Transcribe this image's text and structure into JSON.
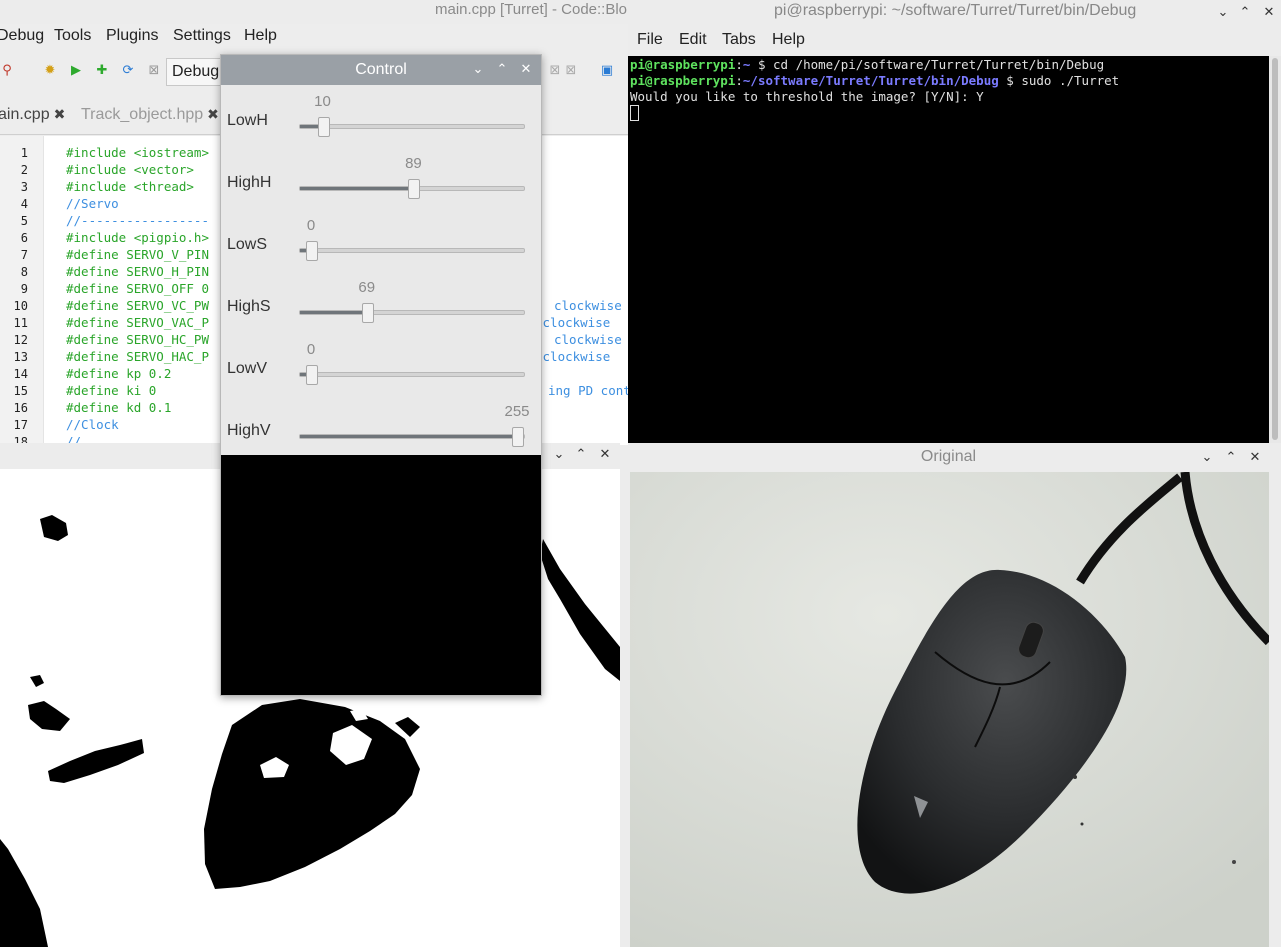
{
  "codeblocks": {
    "title": "main.cpp [Turret] - Code::Blo",
    "menu": [
      "Debug",
      "Tools",
      "Plugins",
      "Settings",
      "Help"
    ],
    "build_target": "Debug",
    "tabs": [
      {
        "label": "ain.cpp",
        "active": true
      },
      {
        "label": "Track_object.hpp",
        "active": false
      }
    ],
    "code_lines": [
      {
        "n": "1",
        "text": "#include <iostream>",
        "kind": "pp"
      },
      {
        "n": "2",
        "text": "#include <vector>",
        "kind": "pp"
      },
      {
        "n": "3",
        "text": "#include <thread>",
        "kind": "pp"
      },
      {
        "n": "4",
        "text": "//Servo",
        "kind": "cm"
      },
      {
        "n": "5",
        "text": "//-----------------",
        "kind": "cm"
      },
      {
        "n": "6",
        "text": "#include <pigpio.h>",
        "kind": "pp"
      },
      {
        "n": "7",
        "text": "#define SERVO_V_PIN",
        "kind": "pp"
      },
      {
        "n": "8",
        "text": "#define SERVO_H_PIN",
        "kind": "pp"
      },
      {
        "n": "9",
        "text": "#define SERVO_OFF 0",
        "kind": "pp"
      },
      {
        "n": "10",
        "text": "#define SERVO_VC_PW",
        "kind": "pp"
      },
      {
        "n": "11",
        "text": "#define SERVO_VAC_P",
        "kind": "pp"
      },
      {
        "n": "12",
        "text": "#define SERVO_HC_PW",
        "kind": "pp"
      },
      {
        "n": "13",
        "text": "#define SERVO_HAC_P",
        "kind": "pp"
      },
      {
        "n": "14",
        "text": "#define kp 0.2",
        "kind": "pp"
      },
      {
        "n": "15",
        "text": "#define ki 0",
        "kind": "pp"
      },
      {
        "n": "16",
        "text": "#define kd 0.1",
        "kind": "pp"
      },
      {
        "n": "17",
        "text": "//Clock",
        "kind": "cm"
      },
      {
        "n": "18",
        "text": "//",
        "kind": "cm"
      }
    ],
    "right_comments": [
      {
        "line": 10,
        "text": "clockwise"
      },
      {
        "line": 11,
        "text": "-clockwise"
      },
      {
        "line": 12,
        "text": "clockwise"
      },
      {
        "line": 13,
        "text": "-clockwise"
      },
      {
        "line": 15,
        "text": "ing PD cont"
      }
    ]
  },
  "terminal": {
    "title": "pi@raspberrypi: ~/software/Turret/Turret/bin/Debug",
    "menu": [
      "File",
      "Edit",
      "Tabs",
      "Help"
    ],
    "line1": {
      "user": "pi@raspberrypi",
      "sep": ":",
      "path": "~",
      "cmd": " $ cd /home/pi/software/Turret/Turret/bin/Debug"
    },
    "line2": {
      "user": "pi@raspberrypi",
      "sep": ":",
      "path": "~/software/Turret/Turret/bin/Debug",
      "cmd": " $ sudo ./Turret"
    },
    "line3": "Would you like to threshold the image? [Y/N]: Y"
  },
  "control": {
    "title": "Control",
    "sliders": [
      {
        "label": "LowH",
        "value": 10,
        "max": 179
      },
      {
        "label": "HighH",
        "value": 89,
        "max": 179
      },
      {
        "label": "LowS",
        "value": 0,
        "max": 255
      },
      {
        "label": "HighS",
        "value": 69,
        "max": 255
      },
      {
        "label": "LowV",
        "value": 0,
        "max": 255
      },
      {
        "label": "HighV",
        "value": 255,
        "max": 255
      }
    ]
  },
  "original": {
    "title": "Original"
  },
  "icons": [
    "minimize-icon",
    "maximize-icon",
    "close-icon",
    "chevron-down-icon"
  ]
}
